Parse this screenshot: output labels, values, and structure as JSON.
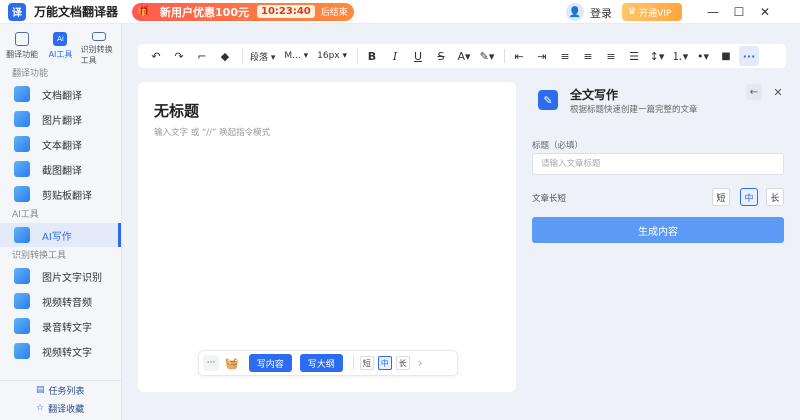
{
  "app": {
    "title": "万能文档翻译器",
    "logo_text": "译"
  },
  "promo": {
    "text": "新用户优惠100元",
    "timer": "10:23:40",
    "end_label": "后结束"
  },
  "header": {
    "login_label": "登录",
    "vip_label": "开通VIP"
  },
  "window_controls": {
    "min": "—",
    "max": "☐",
    "close": "✕"
  },
  "sidebar": {
    "tabs": [
      {
        "label": "翻译功能"
      },
      {
        "label": "AI工具",
        "icon_text": "Ai"
      },
      {
        "label": "识别转换工具"
      }
    ],
    "sections": [
      {
        "label": "翻译功能",
        "items": [
          "文档翻译",
          "图片翻译",
          "文本翻译",
          "截图翻译",
          "剪贴板翻译"
        ]
      },
      {
        "label": "AI工具",
        "items": [
          "AI写作"
        ]
      },
      {
        "label": "识别转换工具",
        "items": [
          "图片文字识别",
          "视频转音频",
          "录音转文字",
          "视频转文字"
        ]
      }
    ],
    "bottom": [
      {
        "label": "任务列表",
        "icon": "list-icon"
      },
      {
        "label": "翻译收藏",
        "icon": "star-icon"
      }
    ]
  },
  "toolbar": {
    "paragraph": "段落 ▾",
    "font": "M... ▾",
    "size": "16px ▾",
    "bold": "B",
    "italic": "I",
    "underline": "U",
    "strike": "S"
  },
  "editor": {
    "title": "无标题",
    "hint": "输入文字 或 “//” 唤起指令模式"
  },
  "float_bar": {
    "more": "···",
    "write_content": "写内容",
    "write_outline": "写大纲",
    "short": "短",
    "medium": "中",
    "long": "长"
  },
  "panel": {
    "title": "全文写作",
    "subtitle": "根据标题快速创建一篇完整的文章",
    "field_label": "标题（必填）",
    "input_placeholder": "请输入文章标题",
    "length_label": "文章长短",
    "options": {
      "short": "短",
      "medium": "中",
      "long": "长"
    },
    "selected": "中",
    "generate": "生成内容"
  },
  "colors": {
    "accent": "#2d6cf0",
    "generate_button": "#5d9af6",
    "promo": "#ff5b4f"
  }
}
